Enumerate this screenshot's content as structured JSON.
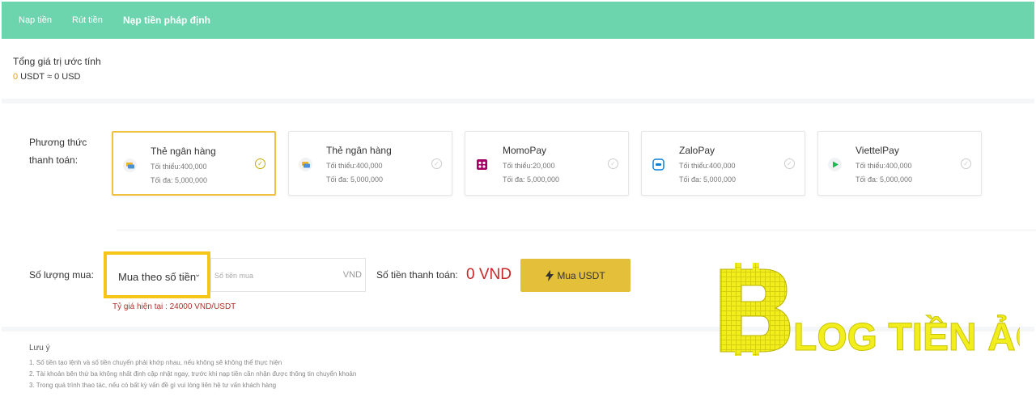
{
  "nav": {
    "tabs": [
      {
        "label": "Nạp tiền"
      },
      {
        "label": "Rút tiền"
      },
      {
        "label": "Nạp tiền pháp định",
        "active": true
      }
    ]
  },
  "summary": {
    "title": "Tổng giá trị ước tính",
    "usdt_amount": "0",
    "rest": " USDT ≈ 0 USD"
  },
  "payment": {
    "label_line1": "Phương thức",
    "label_line2": "thanh toán:",
    "methods": [
      {
        "name": "Thẻ ngân hàng",
        "min": "Tối thiểu:400,000",
        "max": "Tối đa: 5,000,000",
        "icon": "bank-card-icon",
        "selected": true
      },
      {
        "name": "Thẻ ngân hàng",
        "min": "Tối thiểu:400,000",
        "max": "Tối đa: 5,000,000",
        "icon": "bank-card-icon",
        "selected": false
      },
      {
        "name": "MomoPay",
        "min": "Tối thiểu:20,000",
        "max": "Tối đa: 5,000,000",
        "icon": "momo-icon",
        "selected": false
      },
      {
        "name": "ZaloPay",
        "min": "Tối thiểu:400,000",
        "max": "Tối đa: 5,000,000",
        "icon": "zalopay-icon",
        "selected": false
      },
      {
        "name": "ViettelPay",
        "min": "Tối thiểu:400,000",
        "max": "Tối đa: 5,000,000",
        "icon": "viettelpay-icon",
        "selected": false
      }
    ]
  },
  "buy": {
    "qty_label": "Số lượng mua:",
    "mode_selected": "Mua theo số tiền",
    "amount_placeholder": "Số tiền mua",
    "amount_unit": "VND",
    "rate_text": "Tỷ giá hiện tại : 24000 VND/USDT",
    "pay_label": "Số tiền thanh toán:",
    "pay_value": "0 VND",
    "button_label": "Mua USDT"
  },
  "notes": {
    "title": "Lưu ý",
    "items": [
      "1.   Số tiền tạo lệnh và số tiền chuyển phải khớp nhau, nếu không sẽ không thể thực hiện",
      "2.   Tài khoản bên thứ ba không nhất định cập nhật ngay, trước khi nạp tiền cần nhận được thông tin chuyển khoản",
      "3.   Trong quá trình thao tác, nếu có bất kỳ vấn đề gì vui lòng liên hệ tư vấn khách hàng"
    ]
  },
  "watermark": {
    "text": "BLOG TIỀN ẢO",
    "color": "#f2ee1e"
  },
  "colors": {
    "header_bg": "#6dd5ad",
    "accent_gold": "#e4c03a",
    "highlight_yellow": "#f5c518",
    "pay_red": "#c62828",
    "rate_red": "#b0302a"
  }
}
